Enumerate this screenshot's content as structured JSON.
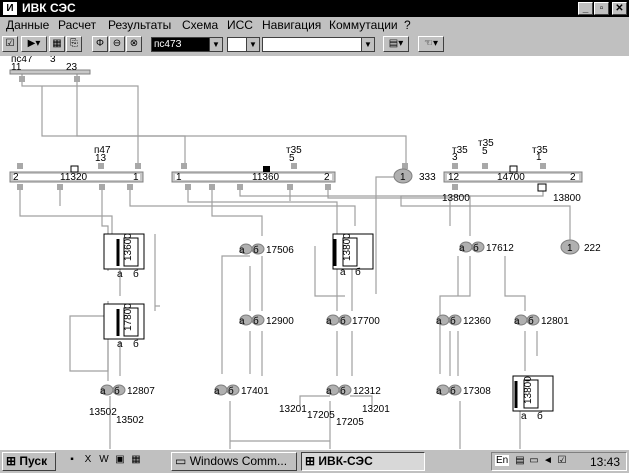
{
  "window": {
    "title": "ИВК СЭС",
    "app_icon": "ivk-icon",
    "min": "_",
    "max": "▫",
    "close": "✕"
  },
  "menu": [
    "Данные",
    "Расчет",
    "Результаты",
    "Схема",
    "ИСС",
    "Навигация",
    "Коммутации",
    "?"
  ],
  "toolbar": {
    "station_value": "пс47З",
    "field2": "",
    "field3": ""
  },
  "diagram": {
    "top_bus": {
      "name": "пс47",
      "num": "3",
      "left": "11",
      "right": "23"
    },
    "busA": {
      "name": "п47",
      "num": "13",
      "left": "2",
      "mid": "11320",
      "right": "1"
    },
    "busB": {
      "name": "т35",
      "num": "5",
      "left": "1",
      "mid": "11360",
      "right": "2"
    },
    "busC": {
      "left_label": "т35",
      "left_num": "3",
      "top_label": "т35",
      "top_num": "5",
      "right_label": "т35",
      "right_num": "1",
      "left": "12",
      "mid": "14700",
      "right": "2",
      "below_left": "13800",
      "below_right": "13800"
    },
    "node333": {
      "id": "1",
      "num": "333"
    },
    "node222": {
      "id": "1",
      "num": "222"
    },
    "trans": [
      {
        "num": "13600",
        "a": "а",
        "b": "б"
      },
      {
        "num": "17800",
        "a": "а",
        "b": "б"
      },
      {
        "num": "13800",
        "a": "а",
        "b": "б"
      },
      {
        "num": "13800",
        "a": "а",
        "b": "б"
      }
    ],
    "switches": [
      {
        "num": "17506"
      },
      {
        "num": "12900"
      },
      {
        "num": "17700"
      },
      {
        "num": "17612"
      },
      {
        "num": "12360"
      },
      {
        "num": "12801"
      },
      {
        "num": "12807"
      },
      {
        "num": "17401"
      },
      {
        "num": "12312"
      },
      {
        "num": "17308"
      }
    ],
    "misc": {
      "a": "а",
      "b": "б",
      "l1": "13502",
      "l2": "13502",
      "l3": "13201",
      "l4": "17205",
      "l5": "17205",
      "l6": "13201"
    }
  },
  "taskbar": {
    "start": "Пуск",
    "tasks": [
      "Windows Comm...",
      "ИВК-СЭС"
    ],
    "lang": "En",
    "clock": "13:43"
  }
}
